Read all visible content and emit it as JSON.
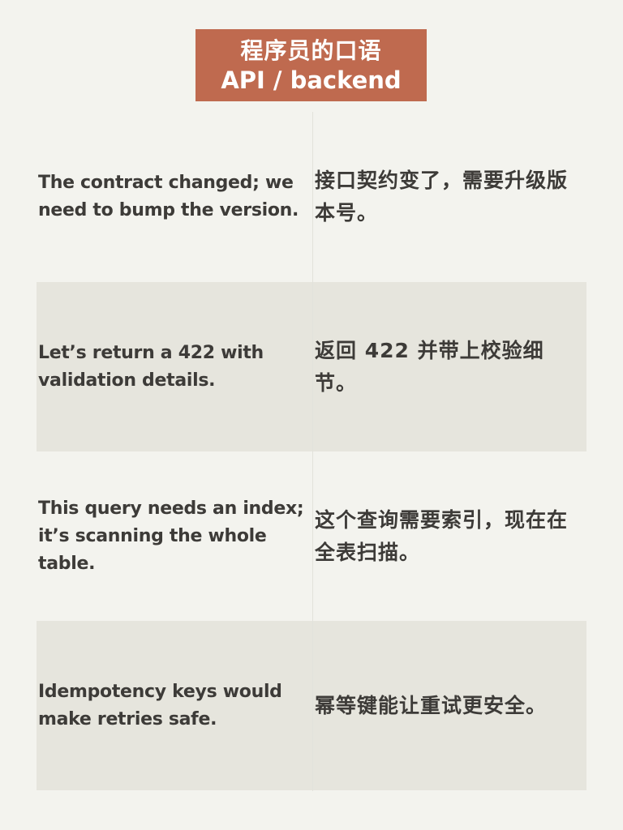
{
  "title": {
    "line1": "程序员的口语",
    "line2": "API / backend",
    "background_color": "#bf6a4f"
  },
  "rows": [
    {
      "en": "The contract changed; we need to bump the version.",
      "zh": "接口契约变了，需要升级版本号。"
    },
    {
      "en": "Let’s return a 422 with validation details.",
      "zh": "返回 422 并带上校验细节。"
    },
    {
      "en": "This query needs an index; it’s scanning the whole table.",
      "zh": "这个查询需要索引，现在在全表扫描。"
    },
    {
      "en": "Idempotency keys would make retries safe.",
      "zh": "幂等键能让重试更安全。"
    }
  ],
  "colors": {
    "page_background": "#f3f3ee",
    "shaded_row": "#e6e5dd",
    "text": "#3d3b38"
  }
}
